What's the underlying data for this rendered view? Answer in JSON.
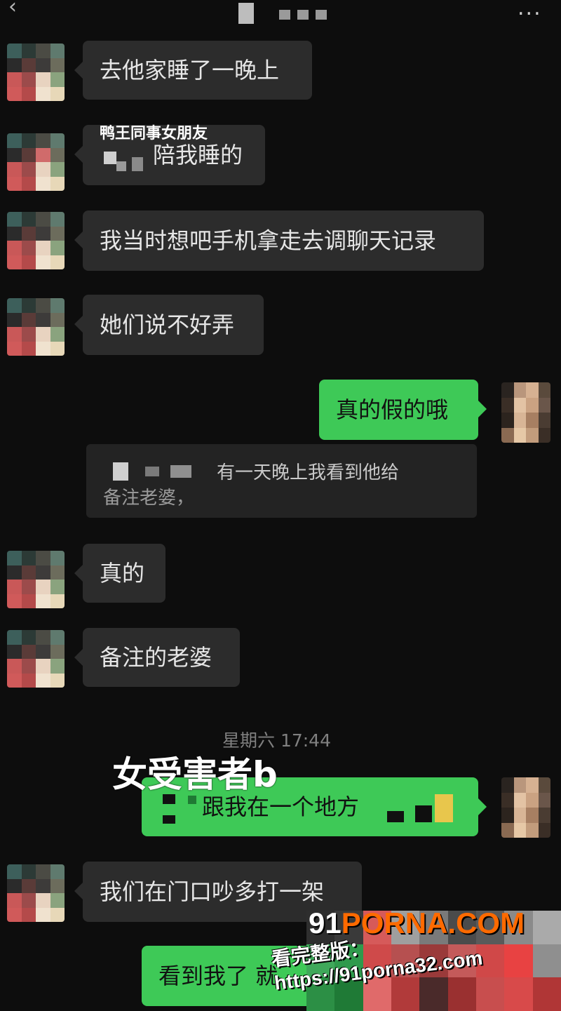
{
  "topbar": {
    "back_icon": "chevron-left-icon",
    "more_label": "..."
  },
  "messages": [
    {
      "side": "in",
      "text": "去他家睡了一晚上"
    },
    {
      "side": "in",
      "overlay": "鸭王同事女朋友",
      "text": "陪我睡的"
    },
    {
      "side": "in",
      "text": "我当时想吧手机拿走去调聊天记录"
    },
    {
      "side": "in",
      "text": "她们说不好弄"
    },
    {
      "side": "out",
      "text": "真的假的哦"
    },
    {
      "side": "quote",
      "line1": "有一天晚上我看到他给",
      "line2": "备注老婆，"
    },
    {
      "side": "in",
      "text": "真的"
    },
    {
      "side": "in",
      "text": "备注的老婆"
    },
    {
      "side": "out",
      "overlay": "女受害者b",
      "text": "跟我在一个地方"
    },
    {
      "side": "in",
      "text": "我们在门口吵多打一架"
    },
    {
      "side": "out",
      "text": "看到我了 就"
    }
  ],
  "timestamp": "星期六 17:44",
  "watermark": {
    "logo_prefix": "91",
    "logo_rest": "PORNA.COM",
    "url": "看完整版：https://91porna32.com"
  },
  "colors": {
    "background": "#0d0d0d",
    "incoming_bubble": "#2c2c2c",
    "outgoing_bubble": "#3ec957"
  }
}
